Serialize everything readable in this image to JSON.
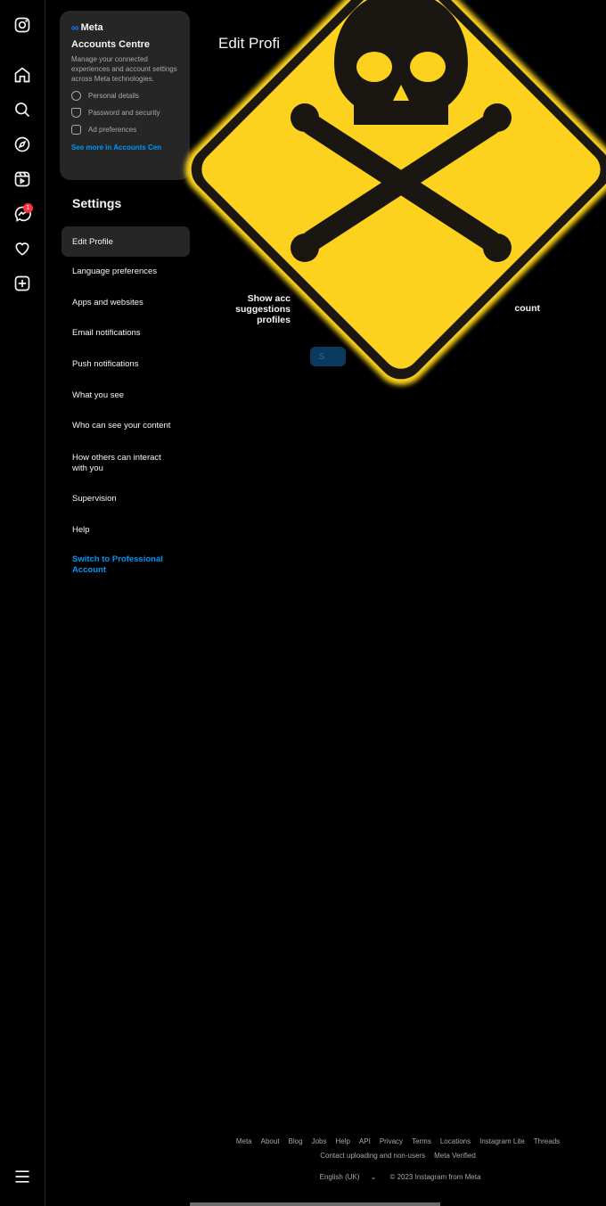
{
  "rail": {
    "icons": [
      "instagram-icon",
      "home-icon",
      "search-icon",
      "explore-icon",
      "reels-icon",
      "messenger-icon",
      "heart-icon",
      "create-icon",
      "menu-icon"
    ],
    "messages_badge": "1"
  },
  "accounts_centre": {
    "brand": "Meta",
    "title": "Accounts Centre",
    "description": "Manage your connected experiences and account settings across Meta technologies.",
    "items": [
      "Personal details",
      "Password and security",
      "Ad preferences"
    ],
    "link": "See more in Accounts Cen"
  },
  "settings": {
    "heading": "Settings",
    "items": [
      "Edit Profile",
      "Language preferences",
      "Apps and websites",
      "Email notifications",
      "Push notifications",
      "What you see",
      "Who can see your content",
      "How others can interact with you",
      "Supervision",
      "Help"
    ],
    "professional": "Switch to Professional Account"
  },
  "main": {
    "title": "Edit Profi",
    "suggestions_line1": "Show acc",
    "suggestions_line2": "suggestions",
    "suggestions_line3": "profiles",
    "right_text": "count",
    "button": "S"
  },
  "footer": {
    "links": [
      "Meta",
      "About",
      "Blog",
      "Jobs",
      "Help",
      "API",
      "Privacy",
      "Terms",
      "Locations",
      "Instagram Lite",
      "Threads"
    ],
    "links2": [
      "Contact uploading and non-users",
      "Meta Verified"
    ],
    "language": "English (UK)",
    "copyright": "© 2023 Instagram from Meta"
  },
  "overlay": {
    "icon": "skull-crossbones-warning-sign",
    "colors": {
      "yellow": "#fcd21f",
      "black": "#1a1712"
    }
  }
}
